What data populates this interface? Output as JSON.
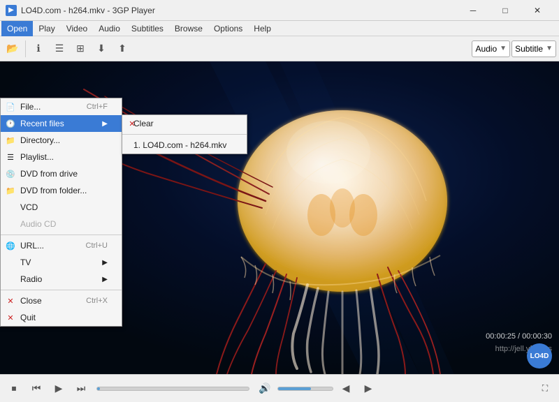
{
  "titlebar": {
    "icon": "▶",
    "title": "LO4D.com - h264.mkv - 3GP Player",
    "min_btn": "─",
    "max_btn": "□",
    "close_btn": "✕"
  },
  "menubar": {
    "items": [
      "Open",
      "Play",
      "Video",
      "Audio",
      "Subtitles",
      "Browse",
      "Options",
      "Help"
    ]
  },
  "toolbar": {
    "buttons": [
      {
        "icon": "📂",
        "name": "open-file-icon"
      },
      {
        "icon": "ℹ",
        "name": "info-icon"
      },
      {
        "icon": "☰",
        "name": "playlist-icon"
      },
      {
        "icon": "⊞",
        "name": "chapters-icon"
      },
      {
        "icon": "⬇",
        "name": "download-icon"
      },
      {
        "icon": "⬆",
        "name": "upload-icon"
      }
    ],
    "audio_label": "Audio",
    "subtitle_label": "Subtitle"
  },
  "open_menu": {
    "items": [
      {
        "label": "File...",
        "shortcut": "Ctrl+F",
        "icon": "📄",
        "disabled": false
      },
      {
        "label": "Recent files",
        "shortcut": "",
        "icon": "🕐",
        "disabled": false,
        "highlighted": true,
        "has_submenu": true
      },
      {
        "label": "Directory...",
        "shortcut": "",
        "icon": "📁",
        "disabled": false
      },
      {
        "label": "Playlist...",
        "shortcut": "",
        "icon": "☰",
        "disabled": false
      },
      {
        "label": "DVD from drive",
        "shortcut": "",
        "icon": "💿",
        "disabled": false
      },
      {
        "label": "DVD from folder...",
        "shortcut": "",
        "icon": "📁",
        "disabled": false
      },
      {
        "label": "VCD",
        "shortcut": "",
        "icon": "",
        "disabled": false
      },
      {
        "label": "Audio CD",
        "shortcut": "",
        "icon": "",
        "disabled": true
      },
      {
        "label": "URL...",
        "shortcut": "Ctrl+U",
        "icon": "🌐",
        "disabled": false
      },
      {
        "label": "TV",
        "shortcut": "",
        "icon": "",
        "disabled": false,
        "has_submenu": true
      },
      {
        "label": "Radio",
        "shortcut": "",
        "icon": "",
        "disabled": false,
        "has_submenu": true
      },
      {
        "label": "Close",
        "shortcut": "Ctrl+X",
        "icon": "✕",
        "disabled": false
      },
      {
        "label": "Quit",
        "shortcut": "",
        "icon": "✕",
        "disabled": false
      }
    ]
  },
  "recent_files_menu": {
    "clear_item": {
      "icon": "✕",
      "label": "Clear"
    },
    "files": [
      {
        "label": "1. LO4D.com - h264.mkv"
      }
    ]
  },
  "video": {
    "watermark": "http://jell.yfish.us",
    "time_current": "00:00:25",
    "time_total": "00:00:30"
  },
  "bottom_controls": {
    "play": "▶",
    "prev": "⏮",
    "next": "⏭",
    "stop": "⏹",
    "volume": "🔊",
    "fullscreen": "⛶"
  }
}
